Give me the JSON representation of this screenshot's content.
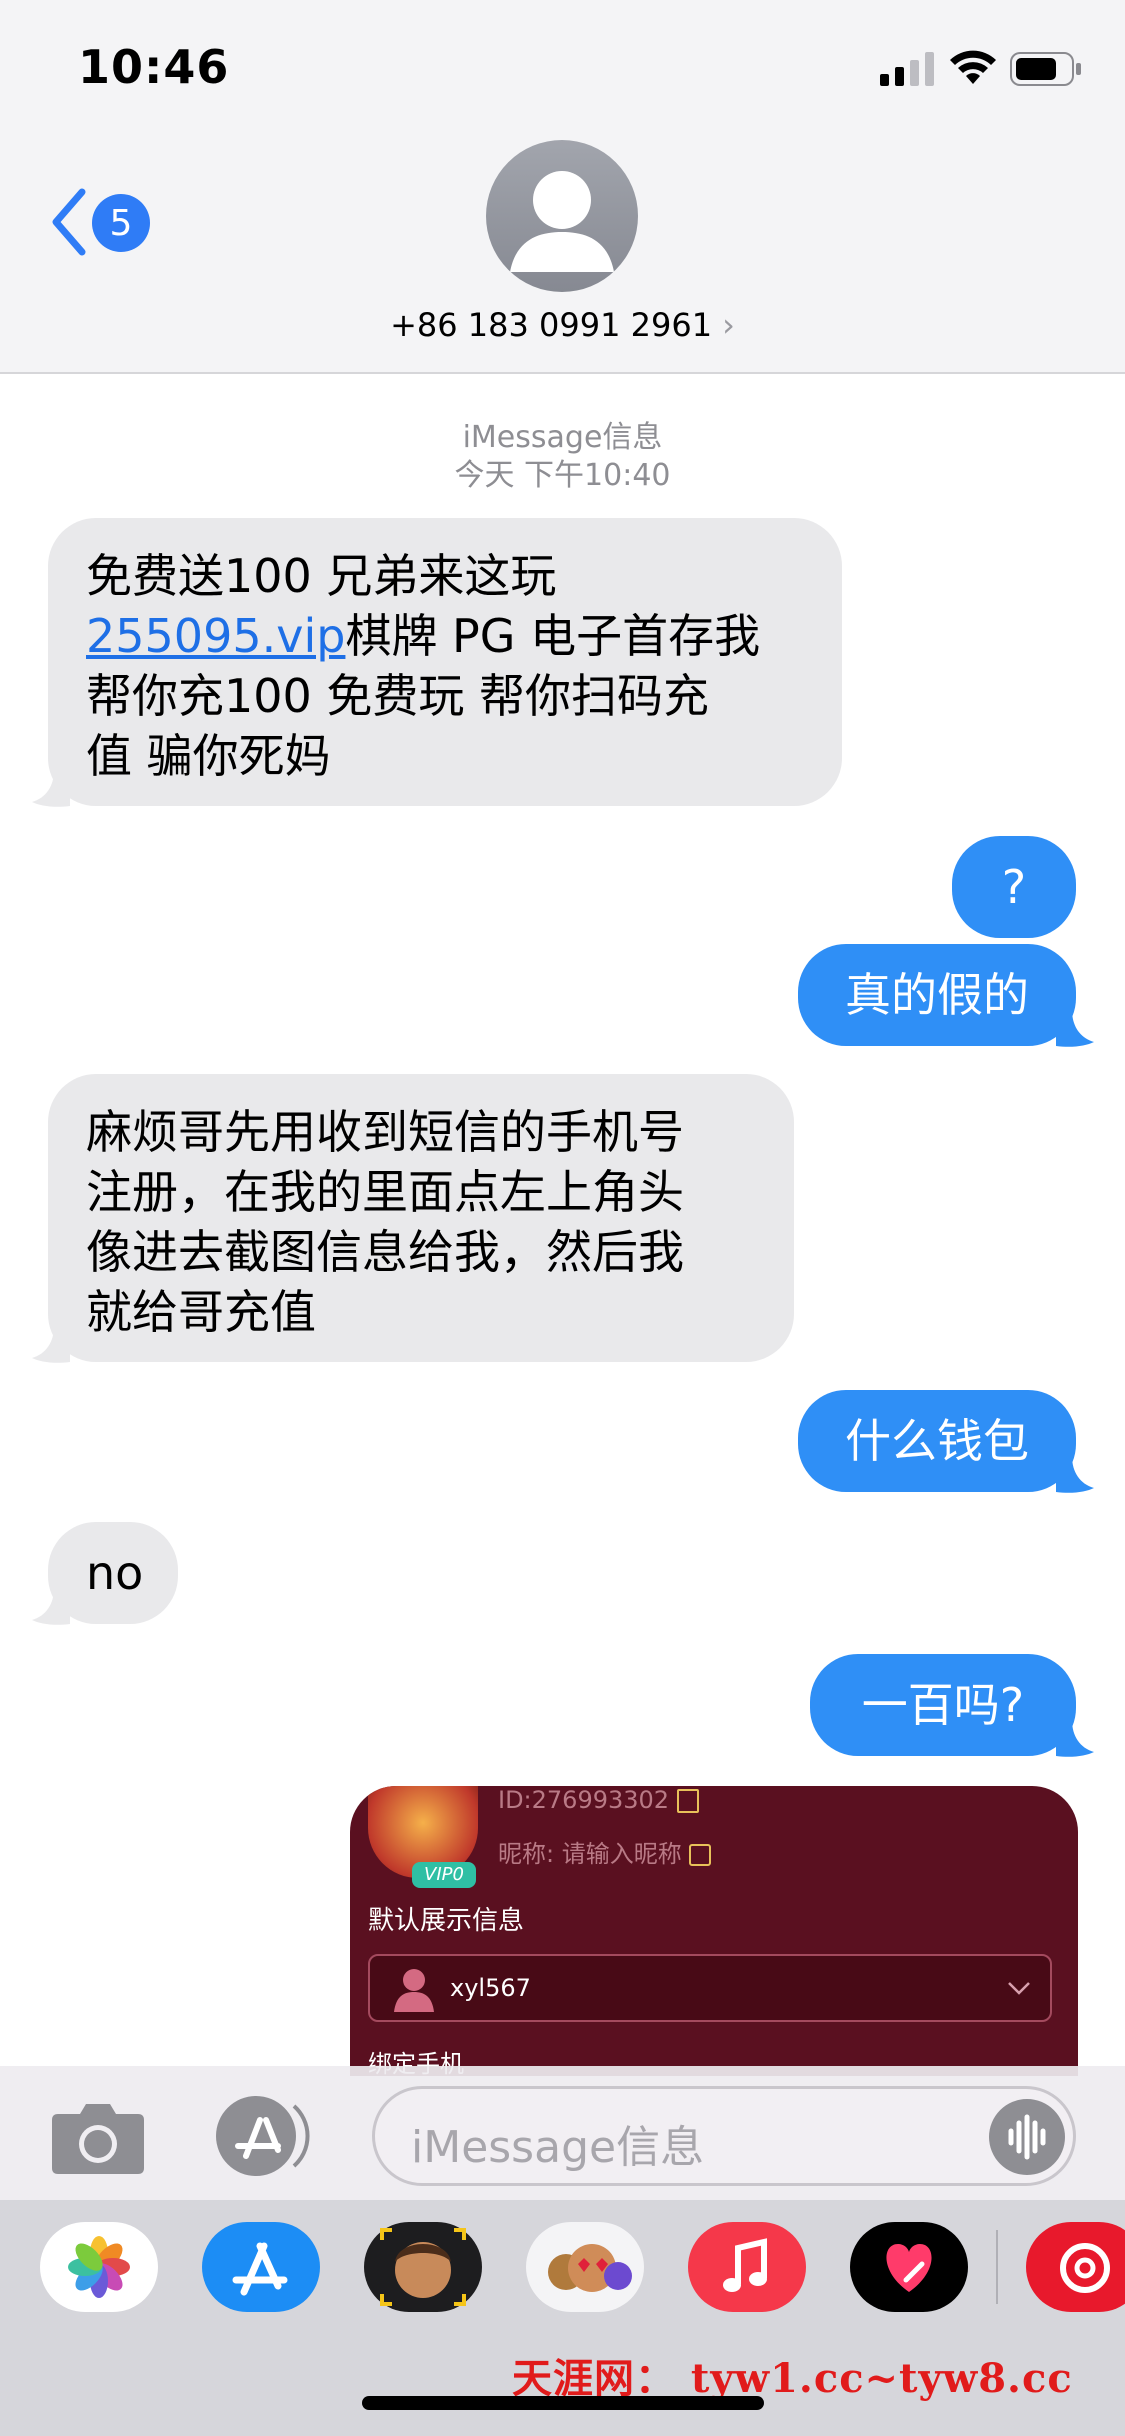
{
  "status_bar": {
    "time": "10:46"
  },
  "header": {
    "back_badge": "5",
    "contact": "+86 183 0991 2961"
  },
  "thread_meta": {
    "service": "iMessage信息",
    "timestamp": "今天 下午10:40"
  },
  "messages": [
    {
      "from": "them",
      "link": "255095.vip",
      "line1": "免费送100 兄弟来这玩",
      "line2_rest": "棋牌 PG 电子首存我",
      "line3": "帮你充100 免费玩 帮你扫码充",
      "line4": "值 骗你死妈"
    },
    {
      "from": "me",
      "text": "?"
    },
    {
      "from": "me",
      "text": "真的假的"
    },
    {
      "from": "them",
      "line1": "麻烦哥先用收到短信的手机号",
      "line2": "注册，在我的里面点左上角头",
      "line3": "像进去截图信息给我，然后我",
      "line4": "就给哥充值"
    },
    {
      "from": "me",
      "text": "什么钱包"
    },
    {
      "from": "them",
      "text": "no"
    },
    {
      "from": "me",
      "text": "一百吗?"
    }
  ],
  "screenshot_card": {
    "id_text": "ID:276993302",
    "nickname_text": "昵称: 请输入昵称",
    "vip": "VIP0",
    "section_label": "默认展示信息",
    "username": "xyl567",
    "bind_phone": "绑定手机"
  },
  "input_bar": {
    "placeholder": "iMessage信息"
  },
  "app_drawer": {
    "apps": [
      "photos-icon",
      "app-store-icon",
      "memoji-camera-icon",
      "memoji-stickers-icon",
      "music-icon",
      "digital-touch-icon",
      "netease-music-icon"
    ]
  },
  "watermark": "天涯网： tyw1.cc~tyw8.cc",
  "colors": {
    "bubble_out": "#2f8ff6",
    "bubble_in": "#e9e9eb",
    "link": "#1e6fe6",
    "card_bg": "#5a1020"
  }
}
